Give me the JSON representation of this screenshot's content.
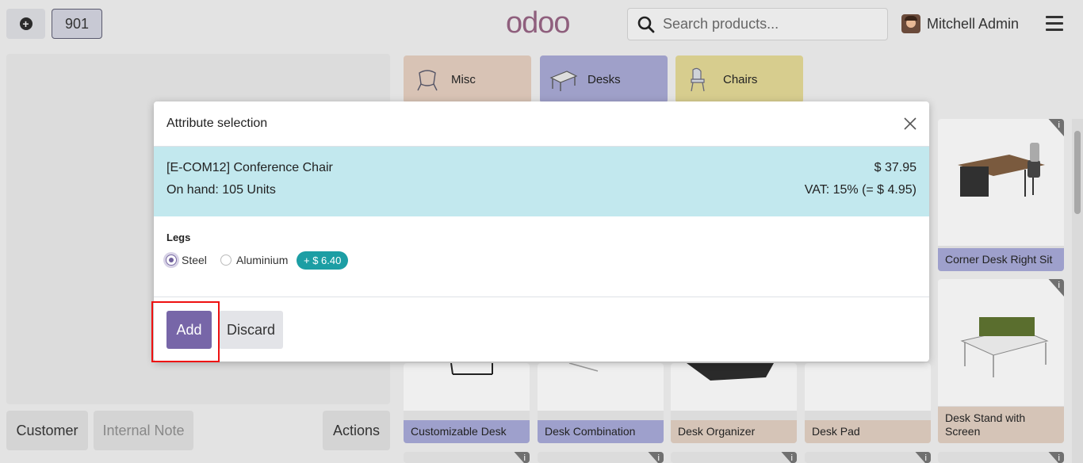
{
  "header": {
    "new_order_icon": "plus-circle-icon",
    "order_number": "901",
    "logo": "odoo",
    "search_placeholder": "Search products...",
    "user_name": "Mitchell Admin"
  },
  "order_pane": {
    "buttons": {
      "customer": "Customer",
      "internal_note": "Internal Note",
      "actions": "Actions"
    }
  },
  "categories": [
    {
      "label": "Misc",
      "color": "#d8c3b5"
    },
    {
      "label": "Desks",
      "color": "#9fa0c9"
    },
    {
      "label": "Chairs",
      "color": "#d7cd8e"
    }
  ],
  "products": [
    {
      "name": "Corner Desk Right Sit"
    },
    {
      "name": "Desk Stand with Screen"
    },
    {
      "name": "Customizable Desk"
    },
    {
      "name": "Desk Combination"
    },
    {
      "name": "Desk Organizer"
    },
    {
      "name": "Desk Pad"
    }
  ],
  "modal": {
    "title": "Attribute selection",
    "product_name": "[E-COM12] Conference Chair",
    "on_hand": "On hand: 105 Units",
    "price": "$ 37.95",
    "vat": "VAT: 15% (= $ 4.95)",
    "attribute_label": "Legs",
    "options": [
      {
        "label": "Steel",
        "selected": true
      },
      {
        "label": "Aluminium",
        "selected": false
      }
    ],
    "extra_price": "+ $ 6.40",
    "add_label": "Add",
    "discard_label": "Discard"
  },
  "colors": {
    "primary": "#7766a8",
    "info_bg": "#c2e8ee",
    "badge": "#1c9ea4",
    "highlight": "#e11"
  }
}
